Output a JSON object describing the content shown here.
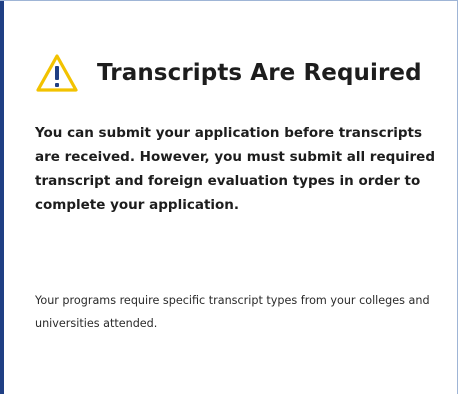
{
  "alert": {
    "icon": "warning-icon",
    "accent_color": "#f2c200",
    "border_color": "#1f3f84",
    "title": "Transcripts Are Required",
    "message": "You can submit your application before transcripts are received. However, you must submit all required transcript and foreign evaluation types in order to complete your application.",
    "note": "Your programs require specific transcript types from your colleges and universities attended."
  }
}
